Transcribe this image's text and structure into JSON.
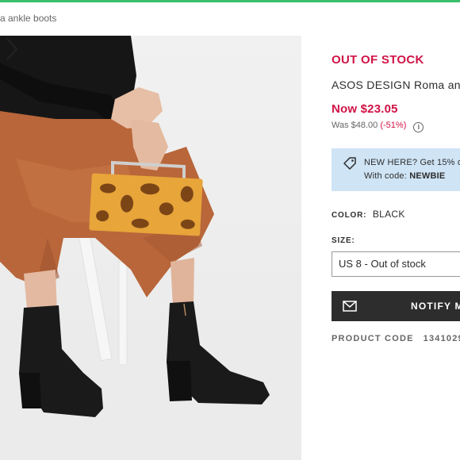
{
  "breadcrumb": "a ankle boots",
  "product": {
    "stock_status": "OUT OF STOCK",
    "name": "ASOS DESIGN Roma an",
    "now_price": "Now $23.05",
    "was_price": "Was $48.00",
    "discount": "(-51%)"
  },
  "promo": {
    "line1": "NEW HERE? Get 15% o",
    "line2_prefix": "With code: ",
    "code": "NEWBIE"
  },
  "color": {
    "label": "COLOR:",
    "value": "BLACK"
  },
  "size": {
    "label": "SIZE:",
    "selected": "US 8 - Out of stock"
  },
  "notify_button": "NOTIFY M",
  "product_code": {
    "label": "PRODUCT CODE",
    "value": "1341029"
  },
  "colors": {
    "accent_red": "#d01345",
    "promo_bg": "#cfe4f5",
    "button_dark": "#2d2d2d",
    "top_bar": "#3ac06b"
  },
  "icons": {
    "next": "chevron-right-icon",
    "info": "info-icon",
    "tag": "tag-icon",
    "mail": "mail-icon"
  }
}
